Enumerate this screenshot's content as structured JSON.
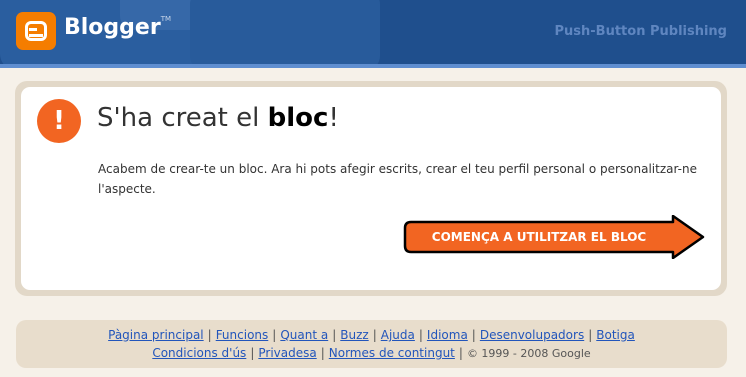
{
  "header": {
    "logo_text": "Blogger",
    "logo_tm": "TM",
    "tagline": "Push-Button Publishing"
  },
  "notice": {
    "icon": "!",
    "title_prefix": "S'ha creat el ",
    "title_bold": "bloc",
    "title_suffix": "!",
    "body": "Acabem de crear-te un bloc. Ara hi pots afegir escrits, crear el teu perfil personal o personalitzar-ne l'aspecte.",
    "cta_label": "COMENÇA A UTILITZAR EL BLOC"
  },
  "footer": {
    "row1": [
      "Pàgina principal",
      "Funcions",
      "Quant a",
      "Buzz",
      "Ajuda",
      "Idioma",
      "Desenvolupadors",
      "Botiga"
    ],
    "row2": [
      "Condicions d'ús",
      "Privadesa",
      "Normes de contingut"
    ],
    "copyright": "© 1999 - 2008 Google"
  },
  "colors": {
    "header_bg": "#1f4f8d",
    "accent": "#f57d00",
    "cta": "#f26522"
  }
}
